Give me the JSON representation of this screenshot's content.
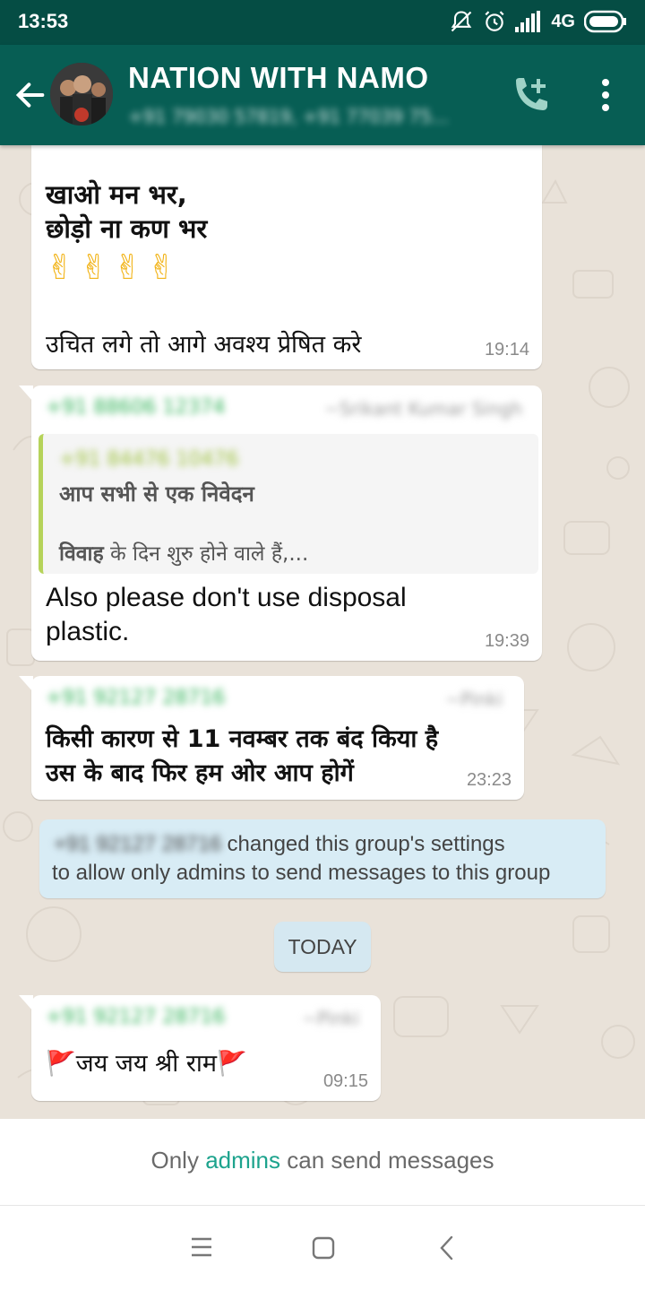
{
  "status_bar": {
    "time": "13:53",
    "network": "4G"
  },
  "header": {
    "title": "NATION WITH NAMO",
    "subtitle": "+91 79030 57819, +91 77039 75..."
  },
  "messages": [
    {
      "lines": [
        "खाओ  मन  भर,",
        "छोड़ो ना कण भर"
      ],
      "emoji": "✌✌✌✌",
      "footer_text": "उचित लगे तो आगे अवश्य प्रेषित करे",
      "time": "19:14"
    },
    {
      "sender": "+91 88606 12374",
      "sender_name": "~Srikant Kumar Singh",
      "quote": {
        "sender": "+91 84476 10476",
        "title": "आप सभी से एक निवेदन",
        "preview_bold": "विवाह",
        "preview_rest": " के दिन शुरु होने वाले हैं,..."
      },
      "text_line1": "Also please don't use disposal",
      "text_line2": "plastic.",
      "time": "19:39"
    },
    {
      "sender": "+91 92127 28716",
      "sender_name": "~Pinki",
      "line1": "किसी कारण से 11 नवम्बर तक बंद किया है",
      "line2": "उस के बाद फिर हम ओर आप होगें",
      "time": "23:23"
    },
    {
      "sender": "+91 92127 28716",
      "sender_name": "~Pinki",
      "flag": "🚩",
      "text": "जय जय श्री राम",
      "time": "09:15"
    }
  ],
  "system_message": {
    "actor": "+91 92127 28716",
    "line1": "changed this group's settings",
    "line2": "to allow only admins to send messages to this group"
  },
  "date_divider": "TODAY",
  "footer": {
    "prefix": "Only ",
    "link": "admins",
    "suffix": " can send messages"
  },
  "colors": {
    "status_bar": "#054d44",
    "app_bar": "#075e54",
    "accent": "#1da38d",
    "sender_green": "#30b257",
    "quote_bar": "#b6d35a"
  },
  "icons": {
    "back": "arrow-left-icon",
    "call": "add-call-icon",
    "menu": "more-vertical-icon"
  }
}
